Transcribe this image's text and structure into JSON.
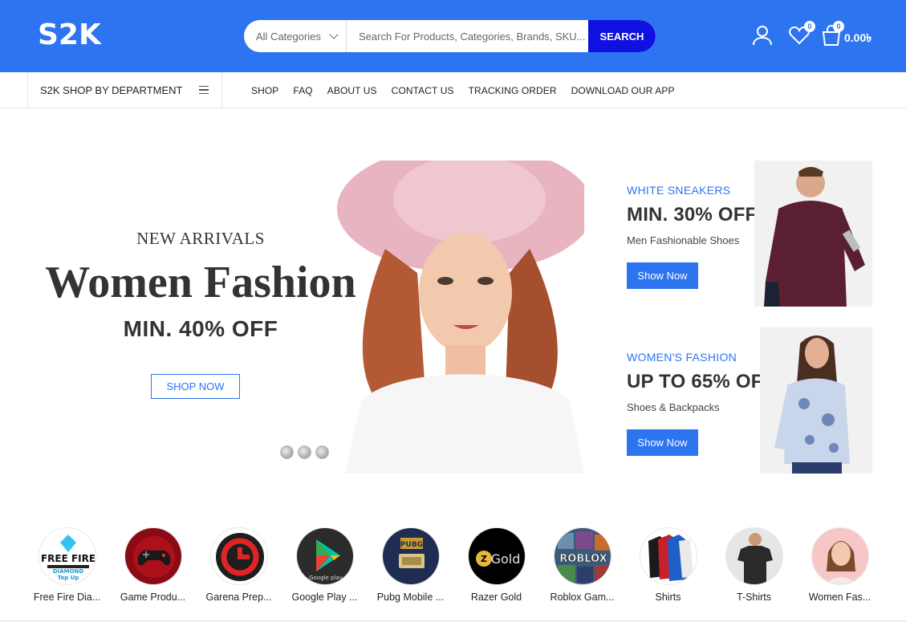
{
  "header": {
    "logo": "S2K",
    "search": {
      "category": "All Categories",
      "placeholder": "Search For Products, Categories, Brands, SKU...",
      "button": "SEARCH"
    },
    "wishlist_count": "0",
    "cart_count": "0",
    "cart_total": "0.00৳"
  },
  "nav": {
    "department": "S2K SHOP BY DEPARTMENT",
    "menu": [
      "SHOP",
      "FAQ",
      "ABOUT US",
      "CONTACT US",
      "TRACKING ORDER",
      "DOWNLOAD OUR APP"
    ]
  },
  "hero": {
    "subtitle": "NEW ARRIVALS",
    "title": "Women Fashion",
    "offer": "MIN. 40% OFF",
    "button": "SHOP NOW"
  },
  "promos": [
    {
      "kicker": "WHITE SNEAKERS",
      "headline": "MIN. 30% OFF",
      "description": "Men Fashionable Shoes",
      "button": "Show Now"
    },
    {
      "kicker": "WOMEN'S FASHION",
      "headline": "UP TO 65% OFF",
      "description": "Shoes & Backpacks",
      "button": "Show Now"
    }
  ],
  "categories": [
    {
      "label": "Free Fire Dia...",
      "icon": "free-fire-icon"
    },
    {
      "label": "Game Produ...",
      "icon": "gamepad-icon"
    },
    {
      "label": "Garena Prep...",
      "icon": "garena-icon"
    },
    {
      "label": "Google Play ...",
      "icon": "google-play-icon"
    },
    {
      "label": "Pubg Mobile ...",
      "icon": "pubg-icon"
    },
    {
      "label": "Razer Gold",
      "icon": "razer-gold-icon"
    },
    {
      "label": "Roblox Gam...",
      "icon": "roblox-icon"
    },
    {
      "label": "Shirts",
      "icon": "shirts-icon"
    },
    {
      "label": "T-Shirts",
      "icon": "tshirt-icon"
    },
    {
      "label": "Women Fas...",
      "icon": "women-fashion-icon"
    }
  ],
  "category_art": {
    "free_fire_top": "FREE FIRE",
    "free_fire_sub": "DIAMOND",
    "free_fire_sub2": "Top Up",
    "google_play": "Google play",
    "pubg": "PUBG",
    "razer_gold": "Gold",
    "roblox": "ROBLOX"
  },
  "colors": {
    "brand": "#2d74f0",
    "search_button": "#1010e0"
  }
}
